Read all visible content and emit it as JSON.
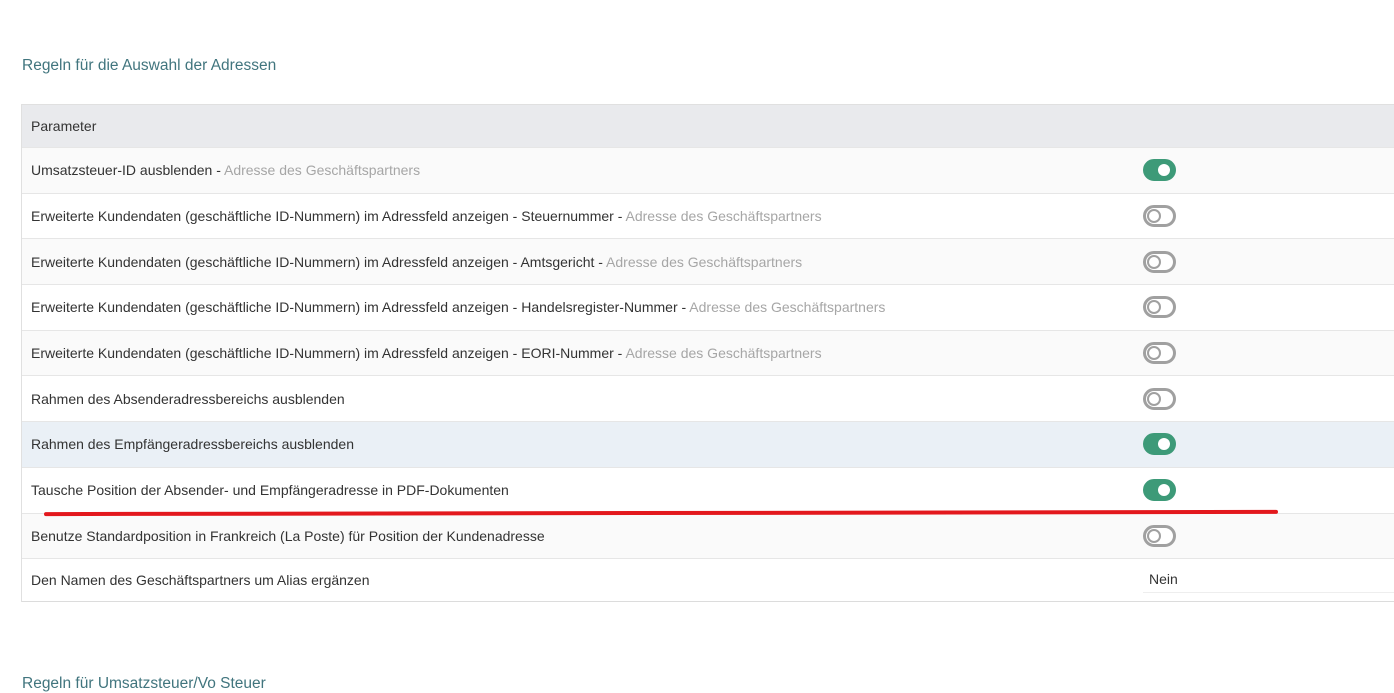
{
  "section": {
    "title": "Regeln für die Auswahl der Adressen",
    "next_title": "Regeln für Umsatzsteuer/Vo Steuer"
  },
  "table": {
    "header": "Parameter",
    "rows": [
      {
        "label": "Umsatzsteuer-ID ausblenden",
        "sep": " - ",
        "scope": "Adresse des Geschäftspartners",
        "enabled": true
      },
      {
        "label": "Erweiterte Kundendaten (geschäftliche ID-Nummern) im Adressfeld anzeigen - Steuernummer",
        "sep": " - ",
        "scope": "Adresse des Geschäftspartners",
        "enabled": false
      },
      {
        "label": "Erweiterte Kundendaten (geschäftliche ID-Nummern) im Adressfeld anzeigen - Amtsgericht",
        "sep": " - ",
        "scope": "Adresse des Geschäftspartners",
        "enabled": false
      },
      {
        "label": "Erweiterte Kundendaten (geschäftliche ID-Nummern) im Adressfeld anzeigen - Handelsregister-Nummer",
        "sep": " - ",
        "scope": "Adresse des Geschäftspartners",
        "enabled": false
      },
      {
        "label": "Erweiterte Kundendaten (geschäftliche ID-Nummern) im Adressfeld anzeigen - EORI-Nummer",
        "sep": " - ",
        "scope": "Adresse des Geschäftspartners",
        "enabled": false
      },
      {
        "label": "Rahmen des Absenderadressbereichs ausblenden",
        "enabled": false
      },
      {
        "label": "Rahmen des Empfängeradressbereichs ausblenden",
        "enabled": true
      },
      {
        "label": "Tausche Position der Absender- und Empfängeradresse in PDF-Dokumenten",
        "enabled": true
      },
      {
        "label": "Benutze Standardposition in Frankreich (La Poste) für Position der Kundenadresse",
        "enabled": false
      },
      {
        "label": "Den Namen des Geschäftspartners um Alias ergänzen",
        "value": "Nein"
      }
    ]
  },
  "colors": {
    "accent_title": "#41757e",
    "switch_on": "#3d9a78",
    "switch_off": "#a0a0a0",
    "annotation": "#e3181d"
  }
}
